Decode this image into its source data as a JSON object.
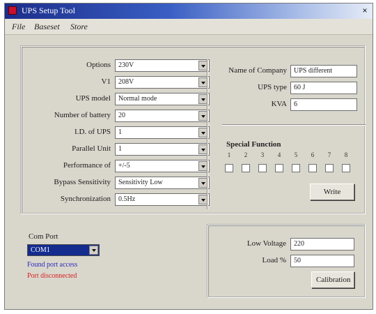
{
  "window": {
    "title": "UPS Setup Tool",
    "close_glyph": "×"
  },
  "menu": {
    "items": [
      "File",
      "Baseset",
      "Store"
    ]
  },
  "settings": {
    "rows": [
      {
        "label": "Options",
        "value": "230V"
      },
      {
        "label": "V1",
        "value": "208V"
      },
      {
        "label": "UPS model",
        "value": "Normal mode"
      },
      {
        "label": "Number of battery",
        "value": "20"
      },
      {
        "label": "I.D. of UPS",
        "value": "1"
      },
      {
        "label": "Parallel Unit",
        "value": "1"
      },
      {
        "label": "Performance of",
        "value": "+/-5"
      },
      {
        "label": "Bypass Sensitivity",
        "value": "Sensitivity Low"
      },
      {
        "label": "Synchronization",
        "value": "0.5Hz"
      }
    ]
  },
  "company": {
    "name_label": "Name of Company",
    "name_value": "UPS different",
    "ups_type_label": "UPS type",
    "ups_type_value": "60 J",
    "kva_label": "KVA",
    "kva_value": "6"
  },
  "special": {
    "title": "Special Function",
    "numbers": [
      "1",
      "2",
      "3",
      "4",
      "5",
      "6",
      "7",
      "8"
    ],
    "checked": [
      false,
      false,
      false,
      false,
      false,
      false,
      false,
      false
    ]
  },
  "buttons": {
    "write": "Write",
    "calibration": "Calibration"
  },
  "com": {
    "title": "Com Port",
    "selected": "COM1",
    "status_ok": "Found port access",
    "status_ok_color": "#2b2bb8",
    "status_err": "Port disconnected",
    "status_err_color": "#d42222"
  },
  "calibration": {
    "low_voltage_label": "Low Voltage",
    "low_voltage_value": "220",
    "load_label": "Load %",
    "load_value": "50"
  }
}
